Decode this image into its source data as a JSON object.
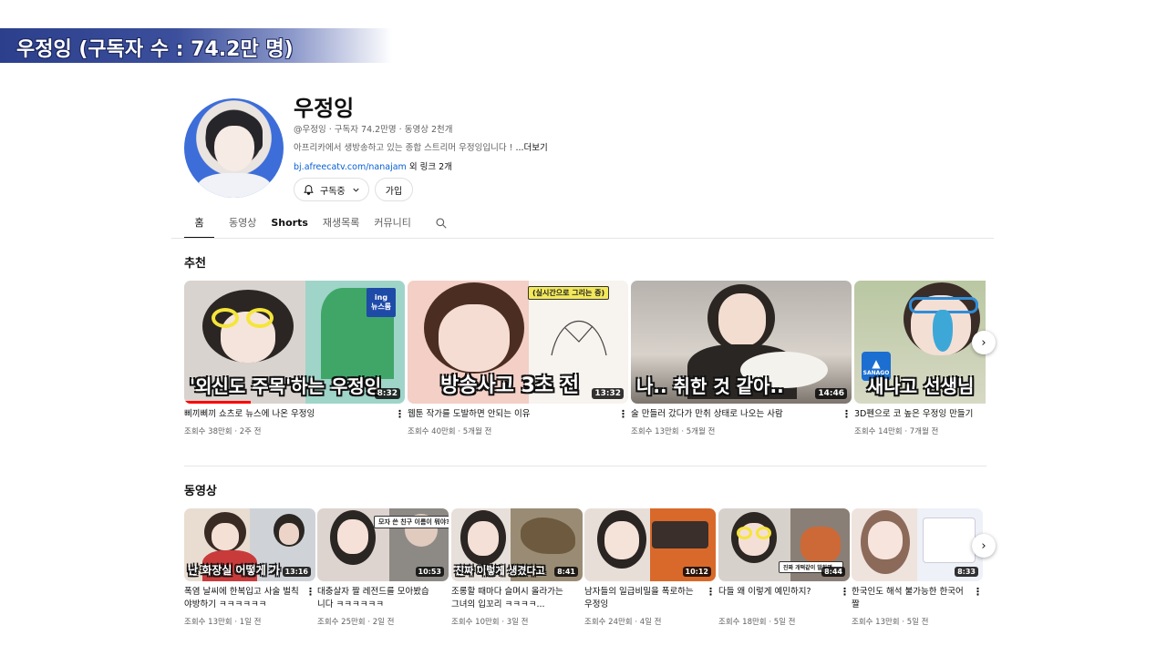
{
  "banner": {
    "text": "우정잉 (구독자 수 : 74.2만 명)"
  },
  "channel": {
    "name": "우정잉",
    "meta": "@우정잉 · 구독자 74.2만명 · 동영상 2천개",
    "description": "아프리카에서 생방송하고 있는 종합 스트리머 우정잉입니다 ! ",
    "more": "...더보기",
    "link_url": "bj.afreecatv.com/nanajam",
    "link_extra": " 외 링크 2개",
    "subscribed_label": "구독중",
    "join_label": "가입"
  },
  "tabs": [
    {
      "label": "홈"
    },
    {
      "label": "동영상"
    },
    {
      "label": "Shorts"
    },
    {
      "label": "재생목록"
    },
    {
      "label": "커뮤니티"
    }
  ],
  "sections": {
    "recommended_title": "추천",
    "videos_title": "동영상"
  },
  "recommended": [
    {
      "caption": "'외신도 주목'하는 우정잉",
      "duration": "8:32",
      "title": "삐끼삐끼 쇼츠로 뉴스에 나온 우정잉",
      "stats": "조회수 38만회 · 2주 전",
      "badge_top": "ing",
      "badge_bottom": "뉴스룸"
    },
    {
      "caption": "방송사고 3초 전",
      "duration": "13:32",
      "title": "웹툰 작가를 도발하면 안되는 이유",
      "stats": "조회수 40만회 · 5개월 전",
      "tag": "(실시간으로 그리는 중)"
    },
    {
      "caption": "나.. 취한 것 같아..",
      "duration": "14:46",
      "title": "술 만들러 갔다가 만취 상태로 나오는 사람",
      "stats": "조회수 13만회 · 5개월 전"
    },
    {
      "caption": "새나고 선생님",
      "duration": "",
      "title": "3D펜으로 코 높은 우정잉 만들기",
      "stats": "조회수 14만회 · 7개월 전",
      "badge_bottom": "SANAGO"
    }
  ],
  "videos": [
    {
      "caption": "난 화장실 어떻게 가",
      "duration": "13:16",
      "title": "폭염 날씨에 한복입고 사술 벌칙 야방하기 ㅋㅋㅋㅋㅋㅋ",
      "stats": "조회수 13만회 · 1일 전"
    },
    {
      "caption": "",
      "duration": "10:53",
      "title": "대충살자 짤 레전드를 모아봤습니다 ㅋㅋㅋㅋㅋㅋ",
      "stats": "조회수 25만회 · 2일 전",
      "tag": "모자 쓴 친구 이름이 뭐야?"
    },
    {
      "caption": "진짜 이렇게 생겼다고",
      "duration": "8:41",
      "title": "조롱할 때마다 슬며시 올라가는 그녀의 입꼬리 ㅋㅋㅋㅋ...",
      "stats": "조회수 10만회 · 3일 전"
    },
    {
      "caption": "",
      "duration": "10:12",
      "title": "남자들의 일급비밀을 폭로하는 우정잉",
      "stats": "조회수 24만회 · 4일 전"
    },
    {
      "caption": "",
      "duration": "8:44",
      "title": "다들 왜 이렇게 예민하지?",
      "stats": "조회수 18만회 · 5일 전",
      "tag": "진짜 개떡같이 말하면..."
    },
    {
      "caption": "",
      "duration": "8:33",
      "title": "한국인도 해석 불가능한 한국어 짤",
      "stats": "조회수 13만회 · 5일 전"
    }
  ],
  "icons": {
    "bell": "bell-icon",
    "chevron": "chevron-down-icon",
    "search": "search-icon",
    "kebab": "more-vert-icon",
    "next": "chevron-right-icon"
  },
  "colors": {
    "banner": "#2c3f8c",
    "link": "#065fd4",
    "progress": "#ff0000"
  }
}
